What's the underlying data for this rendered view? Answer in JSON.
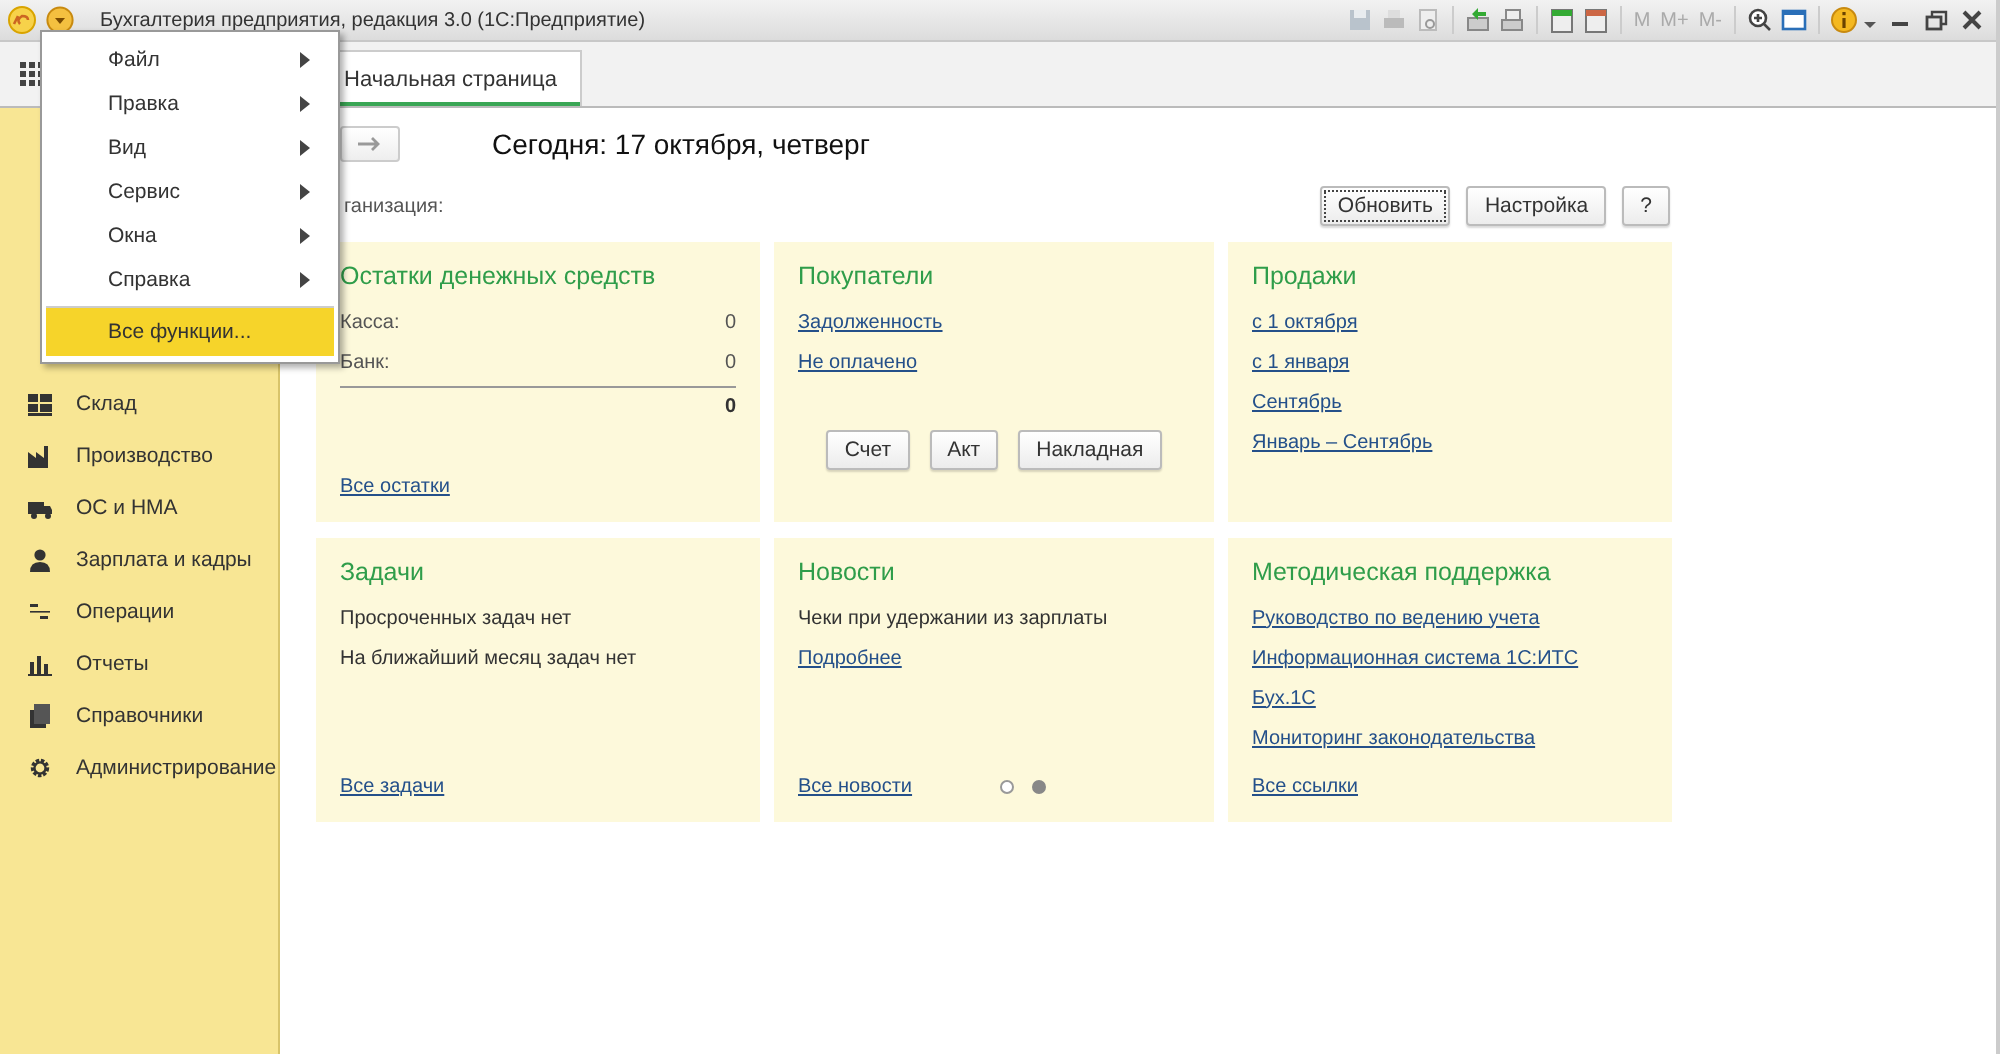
{
  "window": {
    "title": "Бухгалтерия предприятия, редакция 3.0  (1С:Предприятие)"
  },
  "memory_buttons": [
    "M",
    "M+",
    "M-"
  ],
  "main_menu": {
    "items": [
      {
        "label": "Файл",
        "submenu": true,
        "selected": false
      },
      {
        "label": "Правка",
        "submenu": true,
        "selected": false
      },
      {
        "label": "Вид",
        "submenu": true,
        "selected": false
      },
      {
        "label": "Сервис",
        "submenu": true,
        "selected": false
      },
      {
        "label": "Окна",
        "submenu": true,
        "selected": false
      },
      {
        "label": "Справка",
        "submenu": true,
        "selected": false
      },
      {
        "label": "Все функции...",
        "submenu": false,
        "selected": true
      }
    ]
  },
  "tabs": [
    {
      "label": "Начальная страница",
      "selected": true
    }
  ],
  "sidebar": {
    "items": [
      {
        "label": "Склад"
      },
      {
        "label": "Производство"
      },
      {
        "label": "ОС и НМА"
      },
      {
        "label": "Зарплата и кадры"
      },
      {
        "label": "Операции"
      },
      {
        "label": "Отчеты"
      },
      {
        "label": "Справочники"
      },
      {
        "label": "Администрирование"
      }
    ]
  },
  "header": {
    "date": "Сегодня: 17 октября, четверг",
    "organization_label": "ганизация:",
    "buttons": [
      "Обновить",
      "Настройка",
      "?"
    ]
  },
  "cards": [
    {
      "title": "Остатки денежных средств",
      "items": [
        {
          "kind": "row",
          "label": "Касса:",
          "value": "0"
        },
        {
          "kind": "row",
          "label": "Банк:",
          "value": "0"
        },
        {
          "kind": "total",
          "value": "0"
        }
      ],
      "footer": "Все остатки"
    },
    {
      "title": "Покупатели",
      "items": [
        {
          "kind": "link",
          "text": "Задолженность"
        },
        {
          "kind": "link",
          "text": "Не оплачено"
        }
      ],
      "buttons": [
        "Счет",
        "Акт",
        "Накладная"
      ]
    },
    {
      "title": "Продажи",
      "items": [
        {
          "kind": "link",
          "text": "с 1 октября"
        },
        {
          "kind": "link",
          "text": "с 1 января"
        },
        {
          "kind": "link",
          "text": "Сентябрь"
        },
        {
          "kind": "link",
          "text": "Январь – Сентябрь"
        }
      ]
    },
    {
      "title": "Задачи",
      "items": [
        {
          "kind": "text",
          "text": "Просроченных задач нет"
        },
        {
          "kind": "text",
          "text": "На ближайший месяц задач нет"
        }
      ],
      "footer": "Все задачи"
    },
    {
      "title": "Новости",
      "items": [
        {
          "kind": "text",
          "text": "Чеки при удержании из зарплаты"
        },
        {
          "kind": "link",
          "text": "Подробнее"
        }
      ],
      "footer": "Все новости",
      "pages": [
        {
          "selected": false
        },
        {
          "selected": true
        }
      ]
    },
    {
      "title": "Методическая поддержка",
      "items": [
        {
          "kind": "link",
          "text": "Руководство по ведению учета"
        },
        {
          "kind": "link",
          "text": "Информационная система 1С:ИТС"
        },
        {
          "kind": "link",
          "text": "Бух.1С"
        },
        {
          "kind": "link",
          "text": "Мониторинг законодательства"
        }
      ],
      "footer": "Все ссылки"
    }
  ]
}
